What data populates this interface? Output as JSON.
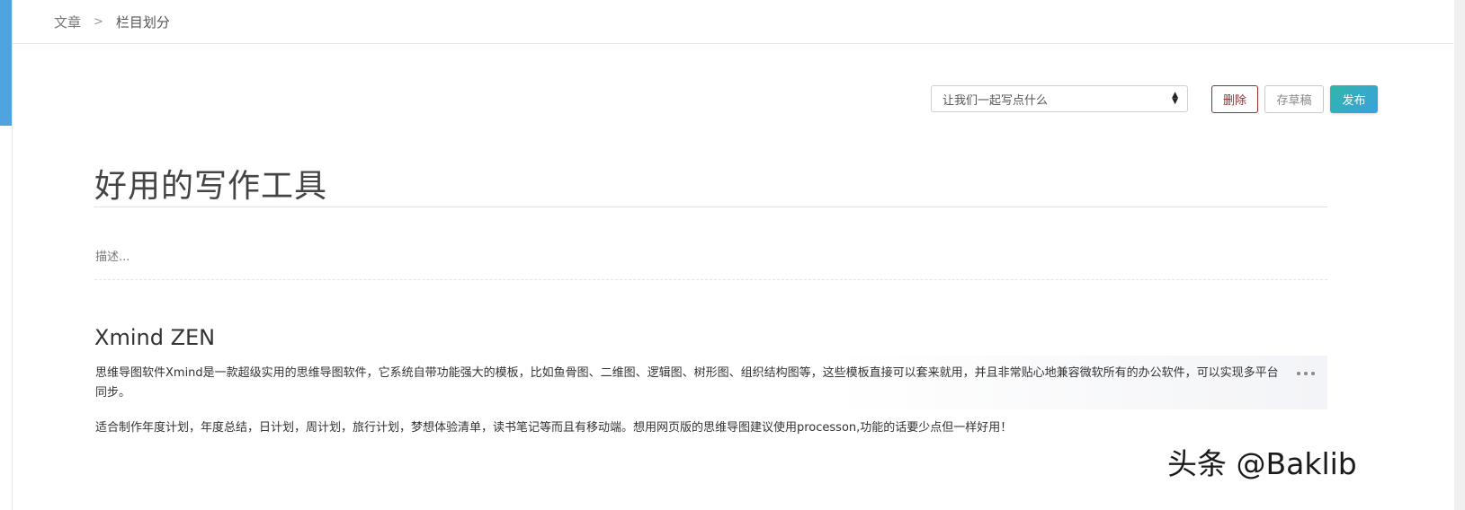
{
  "breadcrumb": {
    "parent": "文章",
    "separator": ">",
    "current": "栏目划分"
  },
  "toolbar": {
    "select_value": "让我们一起写点什么",
    "delete_label": "删除",
    "draft_label": "存草稿",
    "publish_label": "发布"
  },
  "article": {
    "title": "好用的写作工具",
    "description_placeholder": "描述...",
    "section_heading": "Xmind ZEN",
    "paragraph1": "思维导图软件Xmind是一款超级实用的思维导图软件，它系统自带功能强大的模板，比如鱼骨图、二维图、逻辑图、树形图、组织结构图等，这些模板直接可以套来就用，并且非常贴心地兼容微软所有的办公软件，可以实现多平台同步。",
    "paragraph2": "适合制作年度计划，年度总结，日计划，周计划，旅行计划，梦想体验清单，读书笔记等而且有移动端。想用网页版的思维导图建议使用processon,功能的话要少点但一样好用！"
  },
  "watermark": "头条 @Baklib",
  "colors": {
    "accent": "#4fa3df",
    "delete": "#9b2b2b",
    "publish_start": "#2fb7a8",
    "publish_end": "#3aa0e0"
  }
}
